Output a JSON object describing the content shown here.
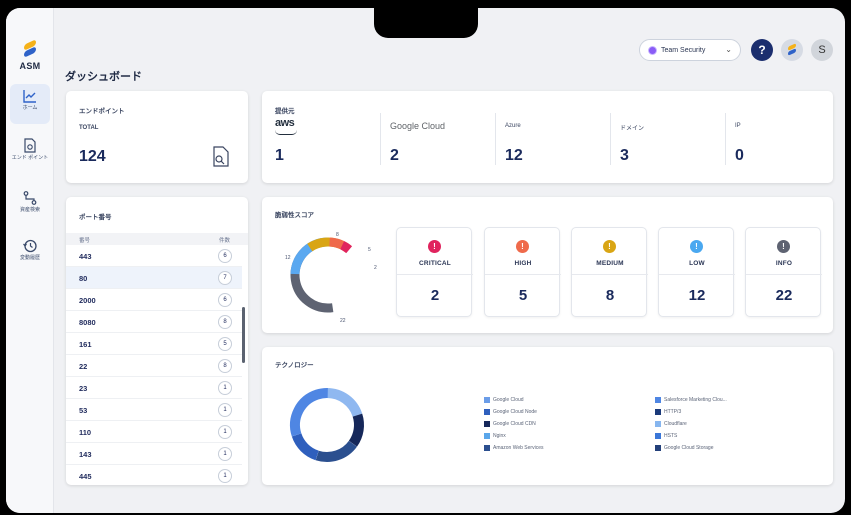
{
  "sidebar": {
    "logo_text": "ASM",
    "items": [
      {
        "label": "ホーム",
        "icon": "chart-line-icon",
        "active": true
      },
      {
        "label": "エンド ポイント",
        "icon": "file-search-icon"
      },
      {
        "label": "資産検索",
        "icon": "route-icon"
      },
      {
        "label": "変動履歴",
        "icon": "history-icon"
      }
    ]
  },
  "topbar": {
    "team_label": "Team Security",
    "help_label": "?",
    "user_initial": "S"
  },
  "page_title": "ダッシュボード",
  "endpoints": {
    "title": "エンドポイント",
    "total_label": "TOTAL",
    "total": "124"
  },
  "providers": {
    "title": "提供元",
    "items": [
      {
        "name": "aws",
        "count": "1"
      },
      {
        "name": "Google Cloud",
        "count": "2"
      },
      {
        "name": "Azure",
        "count": "12"
      },
      {
        "name": "ドメイン",
        "count": "3"
      },
      {
        "name": "IP",
        "count": "0"
      }
    ]
  },
  "ports": {
    "title": "ポート番号",
    "col_port": "番号",
    "col_count": "件数",
    "rows": [
      {
        "port": "443",
        "count": "6"
      },
      {
        "port": "80",
        "count": "7"
      },
      {
        "port": "2000",
        "count": "6"
      },
      {
        "port": "8080",
        "count": "8"
      },
      {
        "port": "161",
        "count": "5"
      },
      {
        "port": "22",
        "count": "8"
      },
      {
        "port": "23",
        "count": "1"
      },
      {
        "port": "53",
        "count": "1"
      },
      {
        "port": "110",
        "count": "1"
      },
      {
        "port": "143",
        "count": "1"
      },
      {
        "port": "445",
        "count": "1"
      }
    ]
  },
  "risk": {
    "title": "脆弱性スコア",
    "donut_labels": [
      "12",
      "2",
      "5",
      "8",
      "22"
    ],
    "severities": [
      {
        "label": "CRITICAL",
        "count": "2",
        "color": "#e0245e",
        "icon": "!"
      },
      {
        "label": "HIGH",
        "count": "5",
        "color": "#ef6a4b",
        "icon": "!"
      },
      {
        "label": "MEDIUM",
        "count": "8",
        "color": "#d9a514",
        "icon": "!"
      },
      {
        "label": "LOW",
        "count": "12",
        "color": "#4aa8f0",
        "icon": "!"
      },
      {
        "label": "INFO",
        "count": "22",
        "color": "#5e6372",
        "icon": "!"
      }
    ]
  },
  "technology": {
    "title": "テクノロジー",
    "legend": [
      {
        "label": "Google Cloud",
        "color": "#6b9de8"
      },
      {
        "label": "Google Cloud Node",
        "color": "#2f5fbd"
      },
      {
        "label": "Google Cloud CDN",
        "color": "#16285a"
      },
      {
        "label": "Nginx",
        "color": "#5aa6ea"
      },
      {
        "label": "Amazon Web Services",
        "color": "#2b4f8f"
      },
      {
        "label": "Salesforce Marketing Clou...",
        "color": "#4f86e3"
      },
      {
        "label": "HTTP/3",
        "color": "#1b3a7a"
      },
      {
        "label": "Cloudflare",
        "color": "#87b6ef"
      },
      {
        "label": "HSTS",
        "color": "#3b77d8"
      },
      {
        "label": "Google Cloud Storage",
        "color": "#23407a"
      }
    ]
  }
}
